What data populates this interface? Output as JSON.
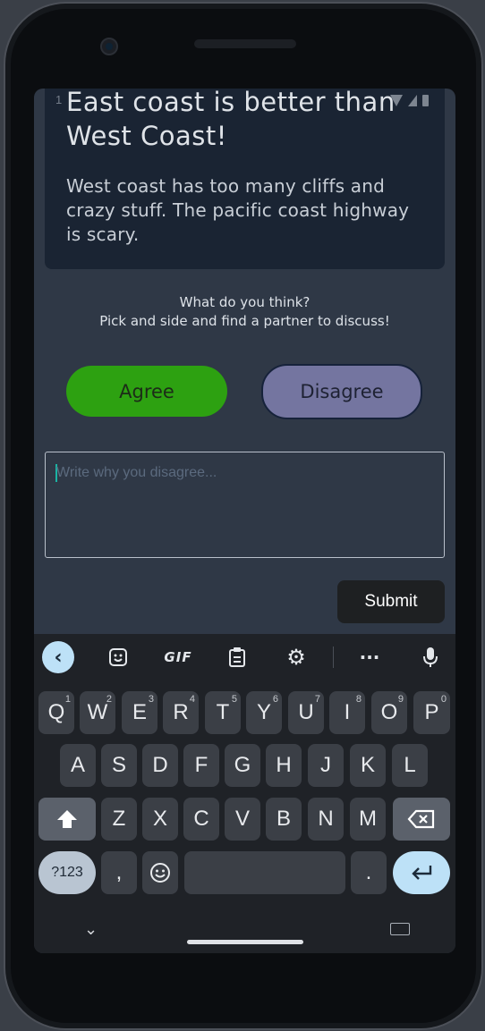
{
  "status_bar": {
    "time": "1"
  },
  "post": {
    "title": "East coast is better than West Coast!",
    "body": "West coast has too many cliffs and crazy stuff.  The pacific coast highway is scary."
  },
  "prompt": {
    "line1": "What do you think?",
    "line2": "Pick and side and find a partner to discuss!"
  },
  "buttons": {
    "agree": "Agree",
    "disagree": "Disagree",
    "submit": "Submit"
  },
  "response": {
    "placeholder": "Write why you disagree...",
    "value": ""
  },
  "keyboard": {
    "toolbar": [
      "back-icon",
      "sticker-icon",
      "GIF",
      "clipboard-icon",
      "gear-icon",
      "more-icon",
      "mic-icon"
    ],
    "row1": [
      {
        "key": "Q",
        "hint": "1"
      },
      {
        "key": "W",
        "hint": "2"
      },
      {
        "key": "E",
        "hint": "3"
      },
      {
        "key": "R",
        "hint": "4"
      },
      {
        "key": "T",
        "hint": "5"
      },
      {
        "key": "Y",
        "hint": "6"
      },
      {
        "key": "U",
        "hint": "7"
      },
      {
        "key": "I",
        "hint": "8"
      },
      {
        "key": "O",
        "hint": "9"
      },
      {
        "key": "P",
        "hint": "0"
      }
    ],
    "row2": [
      "A",
      "S",
      "D",
      "F",
      "G",
      "H",
      "J",
      "K",
      "L"
    ],
    "row3": [
      "Z",
      "X",
      "C",
      "V",
      "B",
      "N",
      "M"
    ],
    "row4": {
      "mode": "?123",
      "comma": ",",
      "period": "."
    },
    "colors": {
      "key": "#3b3f46",
      "accent": "#bde1f7",
      "background": "#1f2227"
    }
  },
  "colors": {
    "screen_bg": "#2f3846",
    "card_bg": "#1a2433",
    "agree": "#2da111",
    "disagree": "#7475a0"
  }
}
